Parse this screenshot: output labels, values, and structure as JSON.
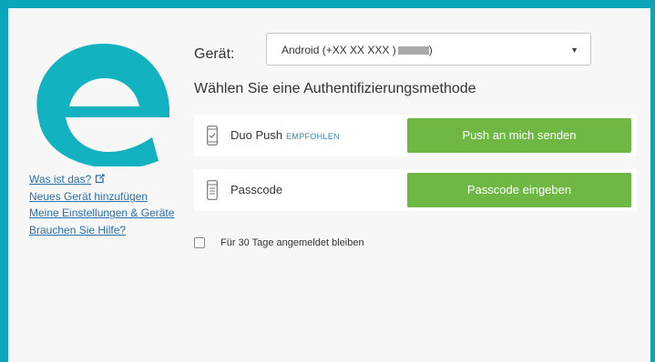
{
  "colors": {
    "frame": "#0aa5b8",
    "panel": "#f7f7f7",
    "logo": "#12b2c0",
    "button": "#6eb743",
    "link": "#2a6fa8",
    "recommended": "#2f8bbd"
  },
  "logo": {
    "icon": "duo-e-logo"
  },
  "sidebar": {
    "links": [
      {
        "label": "Was ist das?",
        "icon": "external-link-icon"
      },
      {
        "label": "Neues Gerät hinzufügen"
      },
      {
        "label": "Meine Einstellungen & Geräte"
      },
      {
        "label": "Brauchen Sie Hilfe?"
      }
    ]
  },
  "device": {
    "label": "Gerät:",
    "selected": "Android (+XX XX XXX )",
    "selected_suffix": ")",
    "caret": "▼"
  },
  "auth": {
    "heading": "Wählen Sie eine Authentifizierungsmethode",
    "methods": [
      {
        "icon": "phone-check-icon",
        "label": "Duo Push",
        "badge": "EMPFOHLEN",
        "button": "Push an mich senden"
      },
      {
        "icon": "passcode-token-icon",
        "label": "Passcode",
        "button": "Passcode eingeben"
      }
    ]
  },
  "remember": {
    "label": "Für 30 Tage angemeldet bleiben",
    "checked": false
  }
}
